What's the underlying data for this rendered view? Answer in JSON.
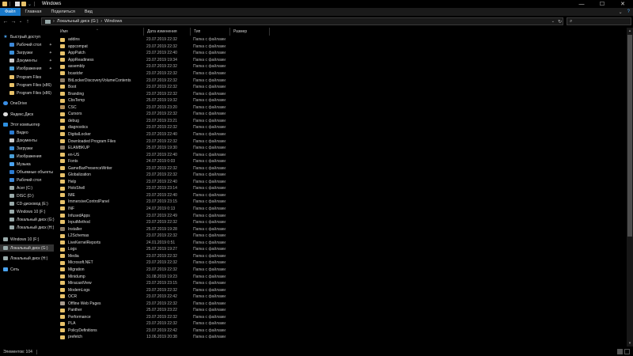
{
  "window": {
    "title": "Windows",
    "minimize_glyph": "—",
    "maximize_glyph": "☐",
    "close_glyph": "✕"
  },
  "ribbon": {
    "tabs": [
      "Файл",
      "Главная",
      "Поделиться",
      "Вид"
    ],
    "expand_glyph": "⌄",
    "help_glyph": "?"
  },
  "nav": {
    "back_glyph": "←",
    "forward_glyph": "→",
    "recent_glyph": "⌄",
    "up_glyph": "↑"
  },
  "address": {
    "separator": "›",
    "path": [
      "Локальный диск (G:)",
      "Windows"
    ],
    "dropdown_glyph": "⌄",
    "refresh_glyph": "↻"
  },
  "search": {
    "icon_glyph": "⌕"
  },
  "sidebar": {
    "items": [
      {
        "label": "Быстрый доступ",
        "icon": "star-icon"
      },
      {
        "label": "Рабочий стол",
        "icon": "desktop-icon",
        "pinned": true
      },
      {
        "label": "Загрузки",
        "icon": "downloads-icon",
        "pinned": true
      },
      {
        "label": "Документы",
        "icon": "documents-icon",
        "pinned": true
      },
      {
        "label": "Изображения",
        "icon": "pictures-icon",
        "pinned": true
      },
      {
        "label": "Program Files",
        "icon": "folder-icon"
      },
      {
        "label": "Program Files (x86)",
        "icon": "folder-icon"
      },
      {
        "label": "Program Files (x86)",
        "icon": "folder-icon"
      },
      {
        "label": "OneDrive",
        "icon": "onedrive-icon"
      },
      {
        "label": "Яндекс.Диск",
        "icon": "yandex-disk-icon"
      },
      {
        "label": "Этот компьютер",
        "icon": "computer-icon"
      },
      {
        "label": "Видео",
        "icon": "video-icon"
      },
      {
        "label": "Документы",
        "icon": "documents-icon"
      },
      {
        "label": "Загрузки",
        "icon": "downloads-icon"
      },
      {
        "label": "Изображения",
        "icon": "pictures-icon"
      },
      {
        "label": "Музыка",
        "icon": "music-icon"
      },
      {
        "label": "Объемные объекты",
        "icon": "3d-objects-icon"
      },
      {
        "label": "Рабочий стол",
        "icon": "desktop-icon"
      },
      {
        "label": "Acer (C:)",
        "icon": "drive-icon"
      },
      {
        "label": "DISC (D:)",
        "icon": "drive-icon"
      },
      {
        "label": "CD-дисковод (E:)",
        "icon": "cd-drive-icon"
      },
      {
        "label": "Windows 10 (F:)",
        "icon": "drive-icon"
      },
      {
        "label": "Локальный диск (G:)",
        "icon": "drive-icon"
      },
      {
        "label": "Локальный диск (H:)",
        "icon": "drive-icon"
      },
      {
        "label": "Windows 10 (F:)",
        "icon": "drive-icon"
      },
      {
        "label": "Локальный диск (G:)",
        "icon": "drive-icon",
        "selected": true
      },
      {
        "label": "Локальный диск (H:)",
        "icon": "drive-icon"
      },
      {
        "label": "Сеть",
        "icon": "network-icon"
      }
    ],
    "pin_glyph": "✦"
  },
  "columns": {
    "name": "Имя",
    "date": "Дата изменения",
    "type": "Тип",
    "size": "Размер",
    "sort_glyph": "^"
  },
  "files": [
    {
      "name": "addins",
      "date": "23.07.2019 22:32",
      "type": "Папка с файлами"
    },
    {
      "name": "appcompat",
      "date": "23.07.2019 22:32",
      "type": "Папка с файлами"
    },
    {
      "name": "AppPatch",
      "date": "23.07.2019 22:40",
      "type": "Папка с файлами"
    },
    {
      "name": "AppReadiness",
      "date": "23.07.2019 19:34",
      "type": "Папка с файлами"
    },
    {
      "name": "assembly",
      "date": "23.07.2019 22:32",
      "type": "Папка с файлами"
    },
    {
      "name": "bcastdvr",
      "date": "23.07.2019 22:32",
      "type": "Папка с файлами"
    },
    {
      "name": "BitLockerDiscoveryVolumeContents",
      "date": "23.07.2019 22:32",
      "type": "Папка с файлами"
    },
    {
      "name": "Boot",
      "date": "23.07.2019 22:32",
      "type": "Папка с файлами"
    },
    {
      "name": "Branding",
      "date": "23.07.2019 22:32",
      "type": "Папка с файлами"
    },
    {
      "name": "CbsTemp",
      "date": "25.07.2019 19:32",
      "type": "Папка с файлами"
    },
    {
      "name": "CSC",
      "date": "23.07.2019 23:20",
      "type": "Папка с файлами"
    },
    {
      "name": "Cursors",
      "date": "23.07.2019 22:32",
      "type": "Папка с файлами"
    },
    {
      "name": "debug",
      "date": "23.07.2019 23:21",
      "type": "Папка с файлами"
    },
    {
      "name": "diagnostics",
      "date": "23.07.2019 22:32",
      "type": "Папка с файлами"
    },
    {
      "name": "DigitalLocker",
      "date": "23.07.2019 22:40",
      "type": "Папка с файлами"
    },
    {
      "name": "Downloaded Program Files",
      "date": "23.07.2019 22:32",
      "type": "Папка с файлами"
    },
    {
      "name": "ELAMBKUP",
      "date": "25.07.2019 19:30",
      "type": "Папка с файлами"
    },
    {
      "name": "en-US",
      "date": "23.07.2019 22:40",
      "type": "Папка с файлами"
    },
    {
      "name": "Fonts",
      "date": "24.07.2019 0:03",
      "type": "Папка с файлами"
    },
    {
      "name": "GameBarPresenceWriter",
      "date": "23.07.2019 22:32",
      "type": "Папка с файлами"
    },
    {
      "name": "Globalization",
      "date": "23.07.2019 22:32",
      "type": "Папка с файлами"
    },
    {
      "name": "Help",
      "date": "23.07.2019 22:40",
      "type": "Папка с файлами"
    },
    {
      "name": "HoloShell",
      "date": "23.07.2019 23:14",
      "type": "Папка с файлами"
    },
    {
      "name": "IME",
      "date": "23.07.2019 22:40",
      "type": "Папка с файлами"
    },
    {
      "name": "ImmersiveControlPanel",
      "date": "23.07.2019 23:15",
      "type": "Папка с файлами"
    },
    {
      "name": "INF",
      "date": "24.07.2019 0:13",
      "type": "Папка с файлами"
    },
    {
      "name": "InfusedApps",
      "date": "23.07.2019 22:49",
      "type": "Папка с файлами"
    },
    {
      "name": "InputMethod",
      "date": "23.07.2019 22:32",
      "type": "Папка с файлами"
    },
    {
      "name": "Installer",
      "date": "25.07.2019 19:28",
      "type": "Папка с файлами"
    },
    {
      "name": "L2Schemas",
      "date": "23.07.2019 22:32",
      "type": "Папка с файлами"
    },
    {
      "name": "LiveKernelReports",
      "date": "24.01.2019 0:51",
      "type": "Папка с файлами"
    },
    {
      "name": "Logs",
      "date": "25.07.2019 19:27",
      "type": "Папка с файлами"
    },
    {
      "name": "Media",
      "date": "23.07.2019 22:32",
      "type": "Папка с файлами"
    },
    {
      "name": "Microsoft.NET",
      "date": "23.07.2019 22:32",
      "type": "Папка с файлами"
    },
    {
      "name": "Migration",
      "date": "23.07.2019 22:32",
      "type": "Папка с файлами"
    },
    {
      "name": "Minidump",
      "date": "31.08.2019 19:23",
      "type": "Папка с файлами"
    },
    {
      "name": "MiracastView",
      "date": "23.07.2019 23:15",
      "type": "Папка с файлами"
    },
    {
      "name": "ModemLogs",
      "date": "23.07.2019 22:32",
      "type": "Папка с файлами"
    },
    {
      "name": "OCR",
      "date": "23.07.2019 22:42",
      "type": "Папка с файлами"
    },
    {
      "name": "Offline Web Pages",
      "date": "23.07.2019 22:32",
      "type": "Папка с файлами"
    },
    {
      "name": "Panther",
      "date": "25.07.2019 23:22",
      "type": "Папка с файлами"
    },
    {
      "name": "Performance",
      "date": "23.07.2019 22:32",
      "type": "Папка с файлами"
    },
    {
      "name": "PLA",
      "date": "23.07.2019 22:32",
      "type": "Папка с файлами"
    },
    {
      "name": "PolicyDefinitions",
      "date": "23.07.2019 22:42",
      "type": "Папка с файлами"
    },
    {
      "name": "prefetch",
      "date": "13.06.2019 20:38",
      "type": "Папка с файлами"
    }
  ],
  "scrollbar": {
    "up_glyph": "▴",
    "down_glyph": "▾"
  },
  "status": {
    "items_count": "Элементов: 104"
  }
}
